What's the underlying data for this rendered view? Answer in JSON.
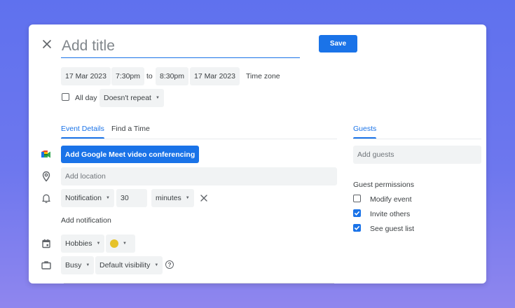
{
  "header": {
    "title_placeholder": "Add title",
    "save_label": "Save"
  },
  "datetime": {
    "start_date": "17 Mar 2023",
    "start_time": "7:30pm",
    "to_label": "to",
    "end_time": "8:30pm",
    "end_date": "17 Mar 2023",
    "time_zone_label": "Time zone"
  },
  "allday": {
    "label": "All day",
    "checked": false,
    "repeat_value": "Doesn't repeat"
  },
  "tabs": [
    {
      "label": "Event Details",
      "active": true
    },
    {
      "label": "Find a Time",
      "active": false
    }
  ],
  "details": {
    "meet_button_label": "Add Google Meet video conferencing",
    "location_placeholder": "Add location",
    "notification_type": "Notification",
    "notification_value": "30",
    "notification_unit": "minutes",
    "add_notification_label": "Add notification",
    "calendar_value": "Hobbies",
    "event_color": "#e6c229",
    "availability_value": "Busy",
    "visibility_value": "Default visibility"
  },
  "guests": {
    "tab_label": "Guests",
    "add_guests_placeholder": "Add guests",
    "permissions_title": "Guest permissions",
    "permissions": [
      {
        "label": "Modify event",
        "checked": false
      },
      {
        "label": "Invite others",
        "checked": true
      },
      {
        "label": "See guest list",
        "checked": true
      }
    ]
  },
  "colors": {
    "accent": "#1a73e8",
    "field_bg": "#f1f3f4"
  }
}
